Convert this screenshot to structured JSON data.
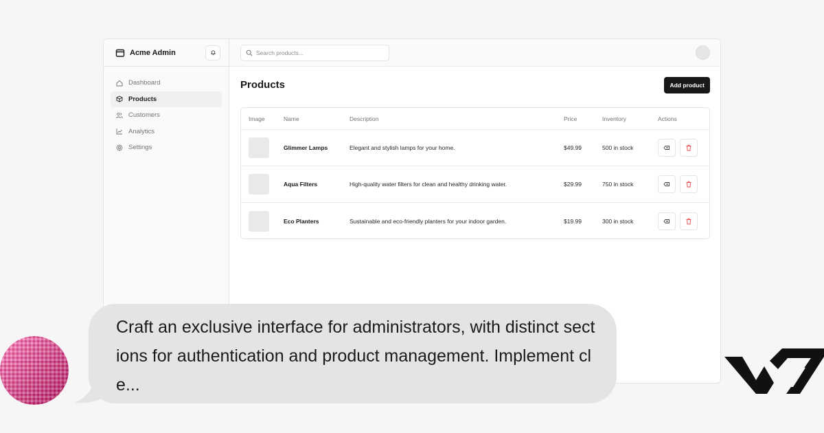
{
  "sidebar": {
    "brand": "Acme Admin",
    "items": [
      {
        "label": "Dashboard",
        "icon": "home-icon"
      },
      {
        "label": "Products",
        "icon": "package-icon",
        "active": true
      },
      {
        "label": "Customers",
        "icon": "users-icon"
      },
      {
        "label": "Analytics",
        "icon": "chart-icon"
      },
      {
        "label": "Settings",
        "icon": "gear-icon"
      }
    ]
  },
  "topbar": {
    "search_placeholder": "Search products..."
  },
  "main": {
    "title": "Products",
    "add_button": "Add product",
    "table": {
      "headers": [
        "Image",
        "Name",
        "Description",
        "Price",
        "Inventory",
        "Actions"
      ],
      "rows": [
        {
          "name": "Glimmer Lamps",
          "description": "Elegant and stylish lamps for your home.",
          "price": "$49.99",
          "inventory": "500 in stock"
        },
        {
          "name": "Aqua Filters",
          "description": "High-quality water filters for clean and healthy drinking water.",
          "price": "$29.99",
          "inventory": "750 in stock"
        },
        {
          "name": "Eco Planters",
          "description": "Sustainable and eco-friendly planters for your indoor garden.",
          "price": "$19.99",
          "inventory": "300 in stock"
        }
      ]
    }
  },
  "chat": {
    "message": "Craft an exclusive interface for administrators, with distinct sections for authentication and product management. Implement cle..."
  },
  "colors": {
    "accent": "#18181b",
    "danger": "#ef4444",
    "avatar_pink": "#e0489a"
  }
}
